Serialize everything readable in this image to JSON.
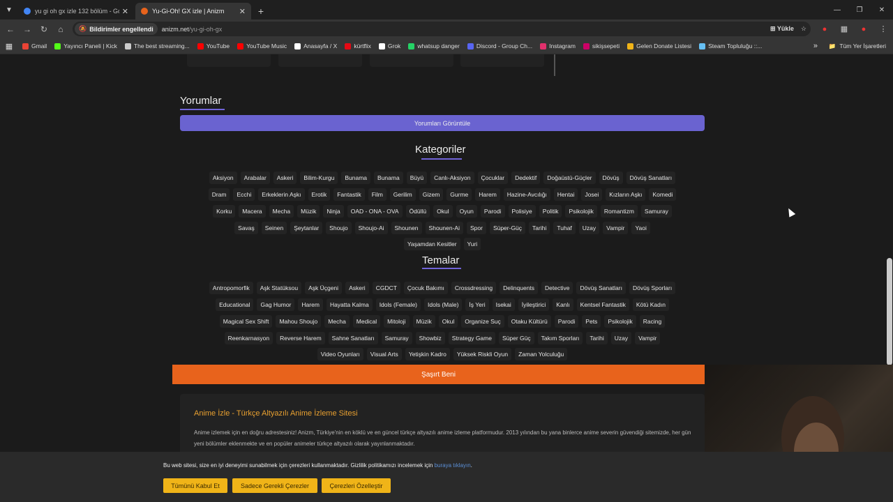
{
  "browser": {
    "tabs": [
      {
        "title": "yu gi oh gx izle 132 bölüm - Go",
        "active": false,
        "favicon_color": "#4285f4"
      },
      {
        "title": "Yu-Gi-Oh! GX izle | Anizm",
        "active": true,
        "favicon_color": "#e8631c"
      }
    ],
    "omnibox": {
      "chip": "Bildirimler engellendi",
      "domain": "anizm.net",
      "path": "/yu-gi-oh-gx",
      "install_label": "Yükle"
    },
    "bookmarks": [
      {
        "label": "Gmail",
        "icon_color": "#ea4335"
      },
      {
        "label": "Yayıncı Paneli | Kick",
        "icon_color": "#53fc18"
      },
      {
        "label": "The best streaming...",
        "icon_color": "#cccccc"
      },
      {
        "label": "YouTube",
        "icon_color": "#ff0000"
      },
      {
        "label": "YouTube Music",
        "icon_color": "#ff0000"
      },
      {
        "label": "Anasayfa / X",
        "icon_color": "#ffffff"
      },
      {
        "label": "kürtflix",
        "icon_color": "#e50914"
      },
      {
        "label": "Grok",
        "icon_color": "#ffffff"
      },
      {
        "label": "whatsup danger",
        "icon_color": "#25d366"
      },
      {
        "label": "Discord - Group Ch...",
        "icon_color": "#5865f2"
      },
      {
        "label": "Instagram",
        "icon_color": "#e1306c"
      },
      {
        "label": "sikişsepeti",
        "icon_color": "#cc0066"
      },
      {
        "label": "Gelen Donate Listesi",
        "icon_color": "#f0b418"
      },
      {
        "label": "Steam Topluluğu ::...",
        "icon_color": "#66c0f4"
      }
    ],
    "all_bookmarks_label": "Tüm Yer İşaretleri"
  },
  "comments": {
    "heading": "Yorumlar",
    "button_label": "Yorumları Görüntüle"
  },
  "categories": {
    "heading": "Kategoriler",
    "rows": [
      [
        "Aksiyon",
        "Arabalar",
        "Askeri",
        "Bilim-Kurgu",
        "Bunama",
        "Bunama",
        "Büyü",
        "Canlı-Aksiyon",
        "Çocuklar",
        "Dedektif",
        "Doğaüstü-Güçler",
        "Dövüş",
        "Dövüş Sanatları"
      ],
      [
        "Dram",
        "Ecchi",
        "Erkeklerin Aşkı",
        "Erotik",
        "Fantastik",
        "Film",
        "Gerilim",
        "Gizem",
        "Gurme",
        "Harem",
        "Hazine-Avcılığı",
        "Hentai",
        "Josei",
        "Kızların Aşkı",
        "Komedi"
      ],
      [
        "Korku",
        "Macera",
        "Mecha",
        "Müzik",
        "Ninja",
        "OAD - ONA - OVA",
        "Ödüllü",
        "Okul",
        "Oyun",
        "Parodi",
        "Polisiye",
        "Politik",
        "Psikolojik",
        "Romantizm",
        "Samuray"
      ],
      [
        "Savaş",
        "Seinen",
        "Şeytanlar",
        "Shoujo",
        "Shoujo-Ai",
        "Shounen",
        "Shounen-Ai",
        "Spor",
        "Süper-Güç",
        "Tarihi",
        "Tuhaf",
        "Uzay",
        "Vampir",
        "Yaoi"
      ],
      [
        "Yaşamdan Kesitler",
        "Yuri"
      ]
    ]
  },
  "themes": {
    "heading": "Temalar",
    "rows": [
      [
        "Antropomorfik",
        "Aşk Statüksou",
        "Aşk Üçgeni",
        "Askeri",
        "CGDCT",
        "Çocuk Bakımı",
        "Crossdressing",
        "Delinquents",
        "Detective",
        "Dövüş Sanatları",
        "Dövüş Sporları"
      ],
      [
        "Educational",
        "Gag Humor",
        "Harem",
        "Hayatta Kalma",
        "Idols (Female)",
        "Idols (Male)",
        "İş Yeri",
        "Isekai",
        "İyileştirici",
        "Kanlı",
        "Kentsel Fantastik",
        "Kötü Kadın"
      ],
      [
        "Magical Sex Shift",
        "Mahou Shoujo",
        "Mecha",
        "Medical",
        "Mitoloji",
        "Müzik",
        "Okul",
        "Organize Suç",
        "Otaku Kültürü",
        "Parodi",
        "Pets",
        "Psikolojik",
        "Racing"
      ],
      [
        "Reenkarnasyon",
        "Reverse Harem",
        "Sahne Sanatları",
        "Samuray",
        "Showbiz",
        "Strategy Game",
        "Süper Güç",
        "Takım Sporları",
        "Tarihi",
        "Uzay",
        "Vampir"
      ],
      [
        "Video Oyunları",
        "Visual Arts",
        "Yetişkin Kadro",
        "Yüksek Riskli Oyun",
        "Zaman Yolculuğu"
      ]
    ]
  },
  "surprise_button_label": "Şaşırt Beni",
  "info": {
    "title": "Anime İzle - Türkçe Altyazılı Anime İzleme Sitesi",
    "text": "Anime izlemek için en doğru adrestesiniz! Anizm, Türkiye'nin en köklü ve en güncel türkçe altyazılı anime izleme platformudur. 2013 yılından bu yana binlerce anime severin güvendiği sitemizde, her gün yeni bölümler eklenmekte ve en popüler animeler türkçe altyazılı olarak yayınlanmaktadır."
  },
  "cookie": {
    "text": "Bu web sitesi, size en iyi deneyimi sunabilmek için çerezleri kullanmaktadır. Gizlilik politikamızı incelemek için",
    "link": "buraya tıklayın",
    "accept_all": "Tümünü Kabul Et",
    "necessary_only": "Sadece Gerekli Çerezler",
    "customize": "Çerezleri Özelleştir"
  }
}
